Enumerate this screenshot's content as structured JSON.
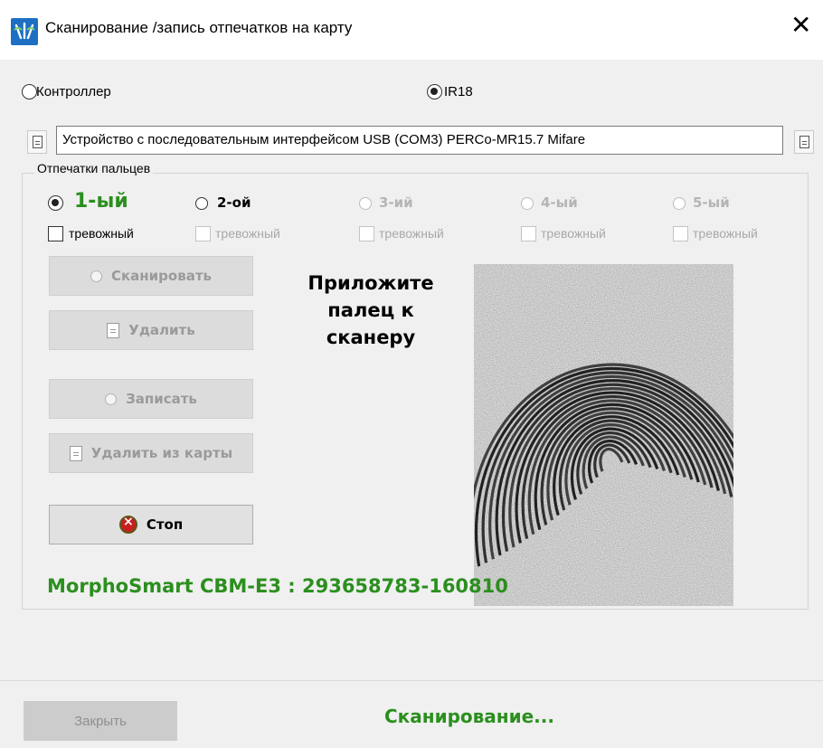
{
  "window": {
    "title": "Сканирование /запись отпечатков на карту",
    "close_glyph": "✕",
    "icon": "app-logo-icon"
  },
  "source": {
    "controller_label": "Контроллер",
    "controller_selected": false,
    "ir18_label": "IR18",
    "ir18_selected": true
  },
  "device": {
    "value": "Устройство с последовательным интерфейсом USB (COM3) PERCo-MR15.7 Mifare",
    "left_icon": "document-icon",
    "right_icon": "document-icon"
  },
  "fingerprints": {
    "group_title": "Отпечатки пальцев",
    "fingers": [
      {
        "label": "1-ый",
        "selected": true,
        "enabled": true,
        "alarm_label": "тревожный",
        "alarm_checked": false,
        "alarm_enabled": true
      },
      {
        "label": "2-ой",
        "selected": false,
        "enabled": true,
        "alarm_label": "тревожный",
        "alarm_checked": false,
        "alarm_enabled": false
      },
      {
        "label": "3-ий",
        "selected": false,
        "enabled": false,
        "alarm_label": "тревожный",
        "alarm_checked": false,
        "alarm_enabled": false
      },
      {
        "label": "4-ый",
        "selected": false,
        "enabled": false,
        "alarm_label": "тревожный",
        "alarm_checked": false,
        "alarm_enabled": false
      },
      {
        "label": "5-ый",
        "selected": false,
        "enabled": false,
        "alarm_label": "тревожный",
        "alarm_checked": false,
        "alarm_enabled": false
      }
    ],
    "buttons": {
      "scan": "Сканировать",
      "delete": "Удалить",
      "write": "Записать",
      "delete_from_card": "Удалить из карты",
      "stop": "Стоп"
    },
    "prompt_line1": "Приложите",
    "prompt_line2": "палец к",
    "prompt_line3": "сканеру",
    "scanner_status": "MorphoSmart CBM-E3 : 293658783-160810"
  },
  "footer": {
    "close_label": "Закрыть",
    "status": "Сканирование..."
  },
  "colors": {
    "accent_green": "#2b8f1e",
    "window_bg": "#f0f0f0",
    "stop_red": "#c81e1e"
  }
}
